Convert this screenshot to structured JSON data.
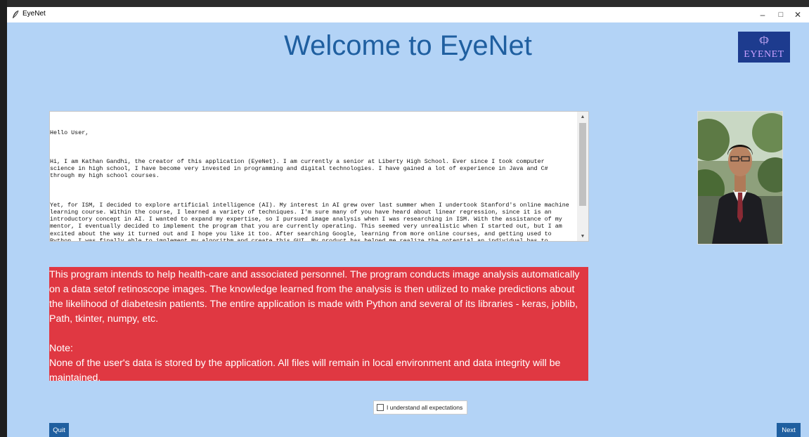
{
  "window": {
    "title": "EyeNet",
    "controls": {
      "minimize": "–",
      "maximize": "□",
      "close": "✕"
    }
  },
  "header": {
    "title": "Welcome to EyeNet",
    "logo_text": "EYENET"
  },
  "bio": {
    "paragraphs": [
      "Hello User,",
      "Hi, I am Kathan Gandhi, the creator of this application (EyeNet). I am currently a senior at Liberty High School. Ever since I took computer science in high school, I have become very invested in programming and digital technologies. I have gained a lot of experience in Java and C# through my high school courses.",
      "Yet, for ISM, I decided to explore artificial intelligence (AI). My interest in AI grew over last summer when I undertook Stanford's online machine learning course. Within the course, I learned a variety of techniques. I'm sure many of you have heard about linear regression, since it is an introductory concept in AI. I wanted to expand my expertise, so I pursued image analysis when I was researching in ISM. With the assistance of my mentor, I eventually decided to implement the program that you are currently operating. This seemed very unrealistic when I started out, but I am excited about the way it turned out and I hope you like it too. After searching Google, learning from more online courses, and getting used to Python, I was finally able to implement my algorithm and create this GUI. My product has helped me realize the potential an individual has to create change and I will continue working on new initiatives even in the future."
    ]
  },
  "info": {
    "description": "This program intends to help health-care and associated personnel. The program conducts image analysis automatically on a data setof retinoscope images. The knowledge learned from the analysis is then utilized to make predictions about the likelihood of diabetesin patients. The entire application is made with Python and several of its libraries - keras, joblib, Path, tkinter, numpy, etc.",
    "note_label": "Note:",
    "note": "None of the user's data is stored by the application. All files will remain in local environment and data integrity will be maintained."
  },
  "agreement": {
    "label": "I understand all expectations",
    "checked": false
  },
  "buttons": {
    "quit": "Quit",
    "next": "Next"
  },
  "colors": {
    "background": "#b3d3f6",
    "heading": "#1f5fa0",
    "info_box": "#e03842",
    "button": "#1f5fa0"
  }
}
